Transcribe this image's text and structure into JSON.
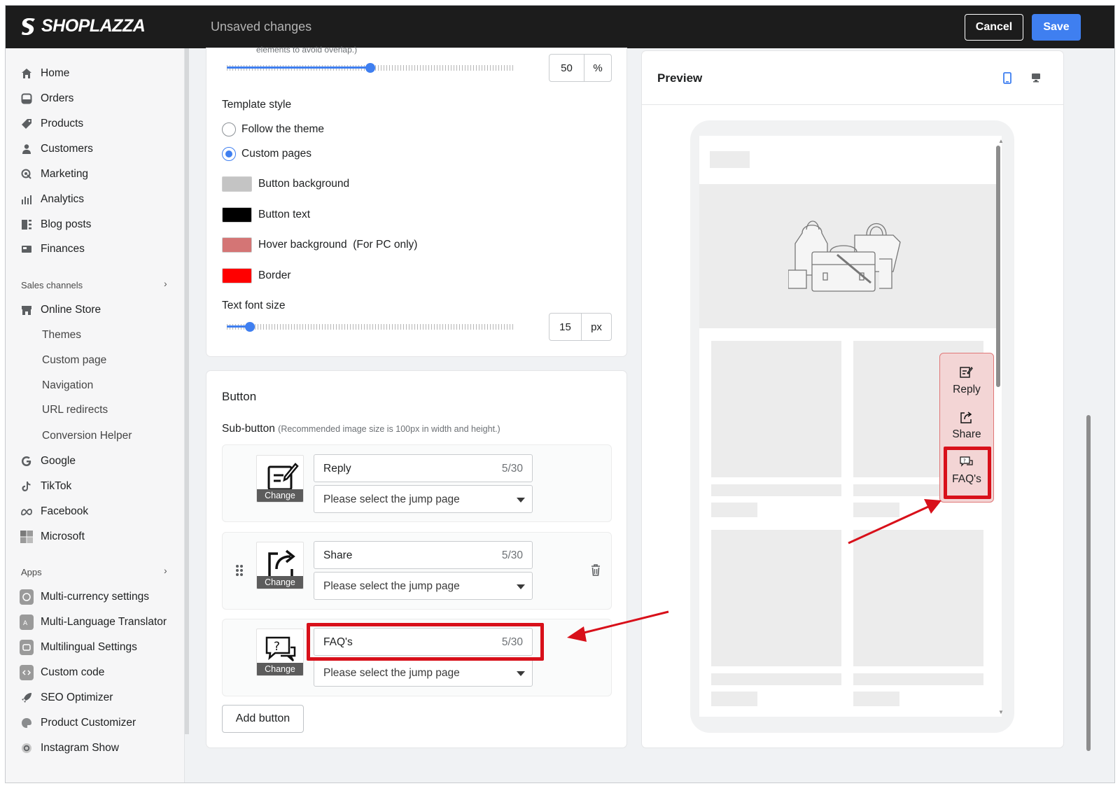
{
  "header": {
    "logo_text": "SHOPLAZZA",
    "status": "Unsaved changes",
    "cancel_label": "Cancel",
    "save_label": "Save"
  },
  "sidebar": {
    "items": [
      {
        "label": "Home",
        "icon": "home-icon"
      },
      {
        "label": "Orders",
        "icon": "orders-icon"
      },
      {
        "label": "Products",
        "icon": "tag-icon"
      },
      {
        "label": "Customers",
        "icon": "person-icon"
      },
      {
        "label": "Marketing",
        "icon": "marketing-icon"
      },
      {
        "label": "Analytics",
        "icon": "analytics-icon"
      },
      {
        "label": "Blog posts",
        "icon": "blog-icon"
      },
      {
        "label": "Finances",
        "icon": "finances-icon"
      }
    ],
    "sales_channels_label": "Sales channels",
    "online_store": "Online Store",
    "online_store_sub": [
      "Themes",
      "Custom page",
      "Navigation",
      "URL redirects",
      "Conversion Helper"
    ],
    "channels": [
      {
        "label": "Google",
        "icon": "google-icon"
      },
      {
        "label": "TikTok",
        "icon": "tiktok-icon"
      },
      {
        "label": "Facebook",
        "icon": "meta-icon"
      },
      {
        "label": "Microsoft",
        "icon": "microsoft-icon"
      }
    ],
    "apps_label": "Apps",
    "apps": [
      {
        "label": "Multi-currency settings",
        "icon": "currency-icon"
      },
      {
        "label": "Multi-Language Translator",
        "icon": "translate-icon"
      },
      {
        "label": "Multilingual Settings",
        "icon": "language-icon"
      },
      {
        "label": "Custom code",
        "icon": "code-icon"
      },
      {
        "label": "SEO Optimizer",
        "icon": "rocket-icon"
      },
      {
        "label": "Product Customizer",
        "icon": "palette-icon"
      },
      {
        "label": "Instagram Show",
        "icon": "instagram-icon"
      }
    ]
  },
  "style_card": {
    "top_hint": "elements to avoid overlap.)",
    "offset_value": "50",
    "offset_unit": "%",
    "offset_level": 0.5,
    "template_style_label": "Template style",
    "radio_follow": "Follow the theme",
    "radio_custom": "Custom pages",
    "swatches": [
      {
        "label": "Button background",
        "color": "#c4c4c4"
      },
      {
        "label": "Button text",
        "color": "#000000"
      },
      {
        "label": "Hover background  (For PC only)",
        "color": "#d47575"
      },
      {
        "label": "Border",
        "color": "#ff0000"
      }
    ],
    "font_size_label": "Text font size",
    "font_size_value": "15",
    "font_size_unit": "px",
    "font_size_level": 0.08
  },
  "button_card": {
    "title": "Button",
    "sub_button_label": "Sub-button",
    "sub_button_hint": "(Recommended image size is 100px in width and height.)",
    "change_label": "Change",
    "select_placeholder": "Please select the jump page",
    "rows": [
      {
        "name": "Reply",
        "count": "5/30",
        "icon": "reply-icon"
      },
      {
        "name": "Share",
        "count": "5/30",
        "icon": "share-icon"
      },
      {
        "name": "FAQ's",
        "count": "5/30",
        "icon": "faq-icon"
      }
    ],
    "add_button_label": "Add button"
  },
  "preview": {
    "title": "Preview",
    "mobile_icon": "mobile-icon",
    "desktop_icon": "desktop-icon",
    "fab_items": [
      {
        "label": "Reply",
        "icon": "reply-icon"
      },
      {
        "label": "Share",
        "icon": "share-icon"
      },
      {
        "label": "FAQ's",
        "icon": "faq-icon"
      }
    ]
  },
  "colors": {
    "accent": "#3f7ff0",
    "highlight": "#d8101a",
    "topbar": "#1c1c1c"
  }
}
